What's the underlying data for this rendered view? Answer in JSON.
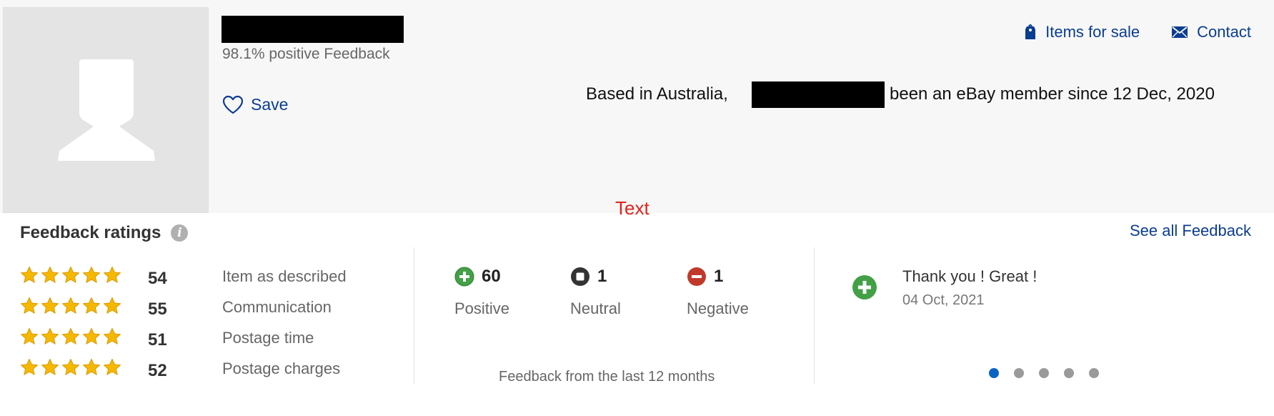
{
  "seller": {
    "positive_feedback": "98.1% positive Feedback",
    "save_label": "Save",
    "based_in_prefix": "Based in Australia, ",
    "member_since_suffix": "been an eBay member since 12 Dec, 2020"
  },
  "links": {
    "items_for_sale": "Items for sale",
    "contact": "Contact",
    "see_all_feedback": "See all Feedback"
  },
  "annotation_text": "Text",
  "feedback": {
    "title": "Feedback ratings",
    "info_icon_glyph": "i",
    "detailed_ratings": [
      {
        "count": "54",
        "label": "Item as described",
        "stars": 5
      },
      {
        "count": "55",
        "label": "Communication",
        "stars": 5
      },
      {
        "count": "51",
        "label": "Postage time",
        "stars": 5
      },
      {
        "count": "52",
        "label": "Postage charges",
        "stars": 5
      }
    ],
    "summary": {
      "positive": {
        "count": "60",
        "label": "Positive"
      },
      "neutral": {
        "count": "1",
        "label": "Neutral"
      },
      "negative": {
        "count": "1",
        "label": "Negative"
      }
    },
    "period_note": "Feedback from the last 12 months",
    "recent": {
      "comment": "Thank you ! Great !",
      "date": "04 Oct, 2021"
    },
    "carousel": {
      "total": 5,
      "active_index": 0
    }
  },
  "colors": {
    "link_blue": "#0b3d91",
    "star_gold": "#f5b800",
    "positive_green": "#43a047",
    "neutral_dark": "#333333",
    "negative_red": "#c0392b",
    "annotation_red": "#e2231a",
    "carousel_active": "#0b62c4"
  },
  "icons": {
    "avatar": "default-user-silhouette",
    "save": "heart-outline-icon",
    "items_for_sale": "price-tag-icon",
    "contact": "envelope-icon",
    "info": "info-icon",
    "rating": "star-icon",
    "positive": "plus-circle-icon",
    "neutral": "square-circle-icon",
    "negative": "minus-circle-icon"
  }
}
